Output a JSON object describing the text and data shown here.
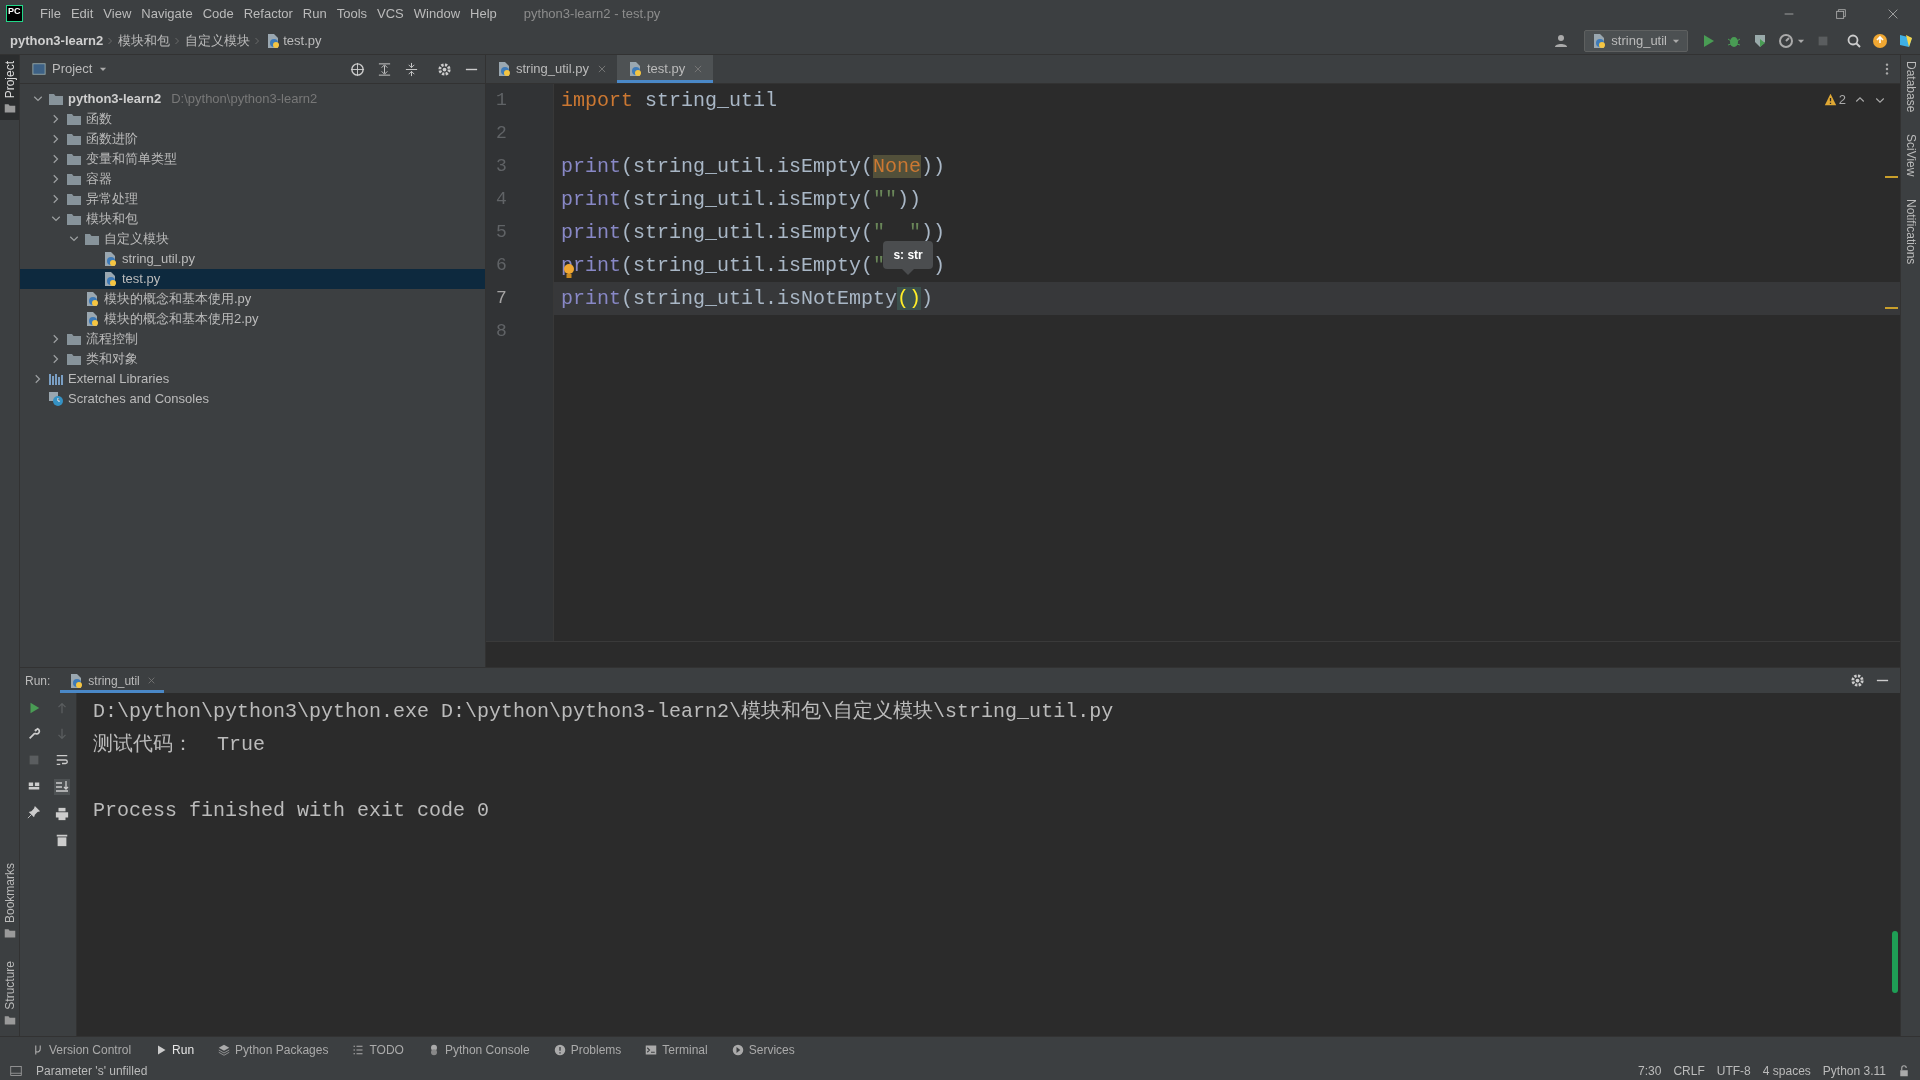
{
  "menu_bar": {
    "logo": "PC",
    "items": [
      "File",
      "Edit",
      "View",
      "Navigate",
      "Code",
      "Refactor",
      "Run",
      "Tools",
      "VCS",
      "Window",
      "Help"
    ],
    "title": "python3-learn2 - test.py"
  },
  "navigation_bar": {
    "breadcrumbs": [
      {
        "label": "python3-learn2",
        "kind": "project"
      },
      {
        "label": "模块和包",
        "kind": "folder"
      },
      {
        "label": "自定义模块",
        "kind": "folder"
      },
      {
        "label": "test.py",
        "kind": "python"
      }
    ],
    "run_configuration": "string_util"
  },
  "left_stripe": {
    "top": [
      {
        "label": "Project",
        "selected": true
      }
    ],
    "bottom": [
      {
        "label": "Bookmarks",
        "selected": false
      },
      {
        "label": "Structure",
        "selected": false
      }
    ]
  },
  "right_stripe": [
    "Database",
    "SciView",
    "Notifications"
  ],
  "project_panel": {
    "title": "Project",
    "tree": [
      {
        "label": "python3-learn2",
        "kind": "project",
        "hint": "D:\\python\\python3-learn2",
        "expanded": true,
        "selected": false,
        "children": [
          {
            "label": "函数",
            "kind": "folder",
            "expanded": false,
            "selected": false
          },
          {
            "label": "函数进阶",
            "kind": "folder",
            "expanded": false,
            "selected": false
          },
          {
            "label": "变量和简单类型",
            "kind": "folder",
            "expanded": false,
            "selected": false
          },
          {
            "label": "容器",
            "kind": "folder",
            "expanded": false,
            "selected": false
          },
          {
            "label": "异常处理",
            "kind": "folder",
            "expanded": false,
            "selected": false
          },
          {
            "label": "模块和包",
            "kind": "folder",
            "expanded": true,
            "selected": false,
            "children": [
              {
                "label": "自定义模块",
                "kind": "folder",
                "expanded": true,
                "selected": false,
                "children": [
                  {
                    "label": "string_util.py",
                    "kind": "python",
                    "selected": false
                  },
                  {
                    "label": "test.py",
                    "kind": "python",
                    "selected": true
                  }
                ]
              },
              {
                "label": "模块的概念和基本使用.py",
                "kind": "python",
                "selected": false
              },
              {
                "label": "模块的概念和基本使用2.py",
                "kind": "python",
                "selected": false
              }
            ]
          },
          {
            "label": "流程控制",
            "kind": "folder",
            "expanded": false,
            "selected": false
          },
          {
            "label": "类和对象",
            "kind": "folder",
            "expanded": false,
            "selected": false
          }
        ]
      },
      {
        "label": "External Libraries",
        "kind": "library",
        "expanded": false,
        "selected": false
      },
      {
        "label": "Scratches and Consoles",
        "kind": "scratches",
        "selected": false
      }
    ]
  },
  "editor": {
    "tabs": [
      {
        "label": "string_util.py",
        "selected": false
      },
      {
        "label": "test.py",
        "selected": true
      }
    ],
    "warnings": "2",
    "lines": [
      {
        "number": "1",
        "current": false,
        "tokens": [
          {
            "kind": "keyword",
            "text": "import"
          },
          {
            "kind": "plain",
            "text": " string_util"
          }
        ]
      },
      {
        "number": "2",
        "current": false
      },
      {
        "number": "3",
        "current": false,
        "tokens": [
          {
            "kind": "builtin",
            "text": "print"
          },
          {
            "kind": "plain",
            "text": "(string_util.isEmpty("
          },
          {
            "kind": "usage",
            "text": "None"
          },
          {
            "kind": "plain",
            "text": "))"
          }
        ]
      },
      {
        "number": "4",
        "current": false,
        "tokens": [
          {
            "kind": "builtin",
            "text": "print"
          },
          {
            "kind": "plain",
            "text": "(string_util.isEmpty("
          },
          {
            "kind": "string",
            "text": "\"\""
          },
          {
            "kind": "plain",
            "text": "))"
          }
        ]
      },
      {
        "number": "5",
        "current": false,
        "tokens": [
          {
            "kind": "builtin",
            "text": "print"
          },
          {
            "kind": "plain",
            "text": "(string_util.isEmpty("
          },
          {
            "kind": "string",
            "text": "\"  \""
          },
          {
            "kind": "plain",
            "text": "))"
          }
        ]
      },
      {
        "number": "6",
        "current": false,
        "bulb": true,
        "tokens": [
          {
            "kind": "builtin",
            "text": "print"
          },
          {
            "kind": "plain",
            "text": "(string_util.isEmpty("
          },
          {
            "kind": "string",
            "text": "\""
          },
          {
            "kind": "tooltip",
            "text": "s: str"
          },
          {
            "kind": "plain",
            "text": ")"
          }
        ]
      },
      {
        "number": "7",
        "current": true,
        "tokens": [
          {
            "kind": "builtin",
            "text": "print"
          },
          {
            "kind": "plain",
            "text": "(string_util.isNotEmpty"
          },
          {
            "kind": "brace",
            "text": "()"
          },
          {
            "kind": "plain",
            "text": ")"
          }
        ]
      },
      {
        "number": "8",
        "current": false
      }
    ]
  },
  "run_panel": {
    "label": "Run:",
    "tab": "string_util",
    "output_blocks": [
      [
        "D:\\python\\python3\\python.exe D:\\python\\python3-learn2\\模块和包\\自定义模块\\string_util.py",
        "测试代码：  True"
      ],
      [
        "Process finished with exit code 0"
      ]
    ]
  },
  "tool_window_bar": [
    {
      "label": "Version Control",
      "kind": "vcs",
      "selected": false
    },
    {
      "label": "Run",
      "kind": "run",
      "selected": true
    },
    {
      "label": "Python Packages",
      "kind": "packages",
      "selected": false
    },
    {
      "label": "TODO",
      "kind": "todo",
      "selected": false
    },
    {
      "label": "Python Console",
      "kind": "console",
      "selected": false
    },
    {
      "label": "Problems",
      "kind": "problems",
      "selected": false
    },
    {
      "label": "Terminal",
      "kind": "terminal",
      "selected": false
    },
    {
      "label": "Services",
      "kind": "services",
      "selected": false
    }
  ],
  "status_bar": {
    "message": "Parameter 's' unfilled",
    "items": [
      "7:30",
      "CRLF",
      "UTF-8",
      "4 spaces",
      "Python 3.11"
    ]
  }
}
